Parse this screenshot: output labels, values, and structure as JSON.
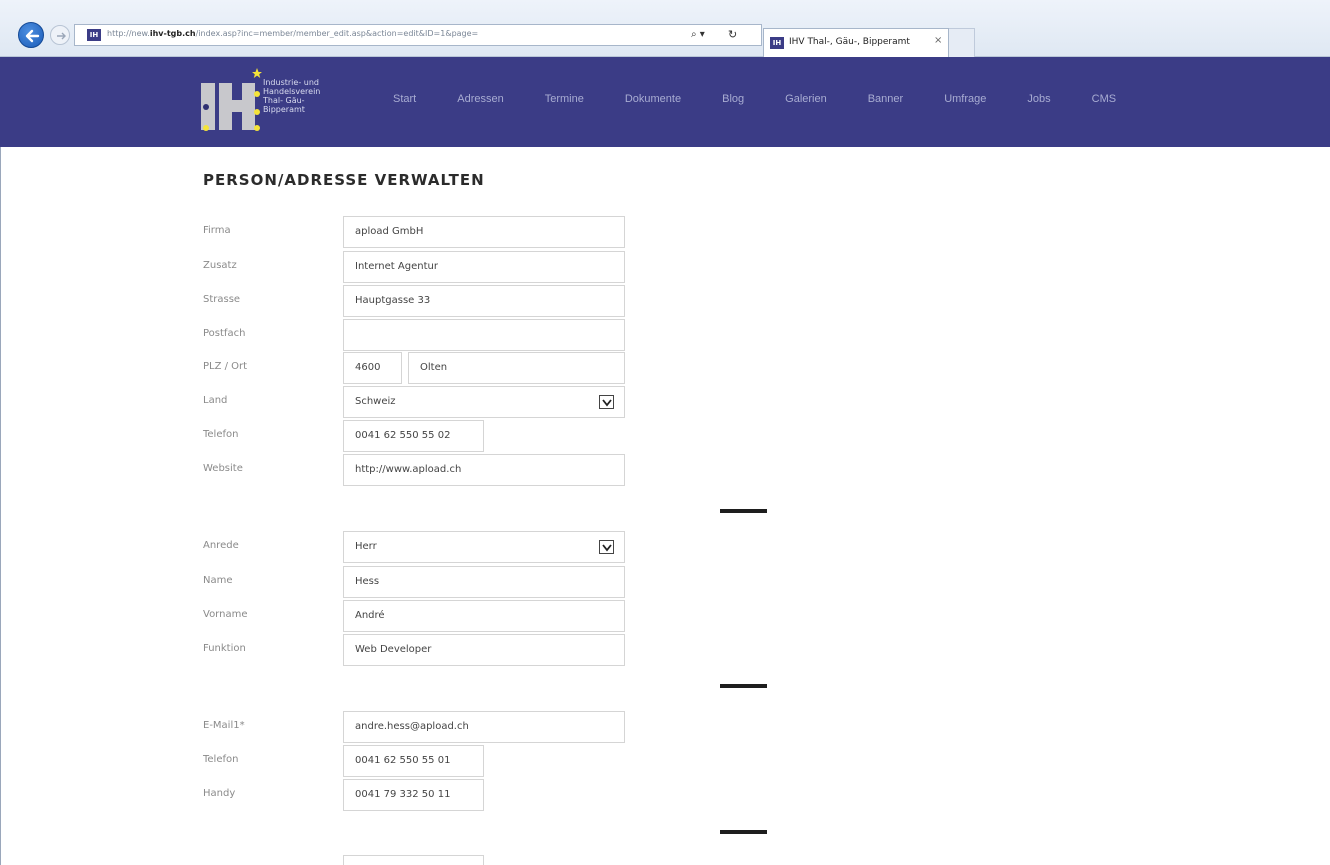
{
  "browser": {
    "url_prefix": "http://new.",
    "url_domain": "ihv-tgb.ch",
    "url_path": "/index.asp?inc=member/member_edit.asp&action=edit&ID=1&page=",
    "tab_title": "IHV Thal-, Gäu-, Bipperamt",
    "favicon_text": "IH",
    "search_glyph": "⌕ ▾",
    "refresh_glyph": "↻",
    "close_glyph": "×"
  },
  "site": {
    "logo_lines": [
      "Industrie- und",
      "Handelsverein",
      "Thal- Gäu-",
      "Bipperamt"
    ],
    "nav": [
      "Start",
      "Adressen",
      "Termine",
      "Dokumente",
      "Blog",
      "Galerien",
      "Banner",
      "Umfrage",
      "Jobs",
      "CMS"
    ],
    "colors": {
      "header_bg": "#3b3c86",
      "accent_yellow": "#f4e33a",
      "logo_grey": "#c8c8cc"
    }
  },
  "page": {
    "title": "PERSON/ADRESSE VERWALTEN"
  },
  "address": {
    "firma": {
      "label": "Firma",
      "value": "apload GmbH"
    },
    "zusatz": {
      "label": "Zusatz",
      "value": "Internet Agentur"
    },
    "strasse": {
      "label": "Strasse",
      "value": "Hauptgasse 33"
    },
    "postfach": {
      "label": "Postfach",
      "value": ""
    },
    "plz_ort": {
      "label": "PLZ / Ort",
      "plz": "4600",
      "ort": "Olten"
    },
    "land": {
      "label": "Land",
      "value": "Schweiz"
    },
    "telefon": {
      "label": "Telefon",
      "value": "0041 62 550 55 02"
    },
    "website": {
      "label": "Website",
      "value": "http://www.apload.ch"
    }
  },
  "person": {
    "anrede": {
      "label": "Anrede",
      "value": "Herr"
    },
    "name": {
      "label": "Name",
      "value": "Hess"
    },
    "vorname": {
      "label": "Vorname",
      "value": "André"
    },
    "funktion": {
      "label": "Funktion",
      "value": "Web Developer"
    }
  },
  "contact": {
    "email1": {
      "label": "E-Mail1*",
      "value": "andre.hess@apload.ch"
    },
    "telefon": {
      "label": "Telefon",
      "value": "0041 62 550 55 01"
    },
    "handy": {
      "label": "Handy",
      "value": "0041 79 332 50 11"
    }
  }
}
